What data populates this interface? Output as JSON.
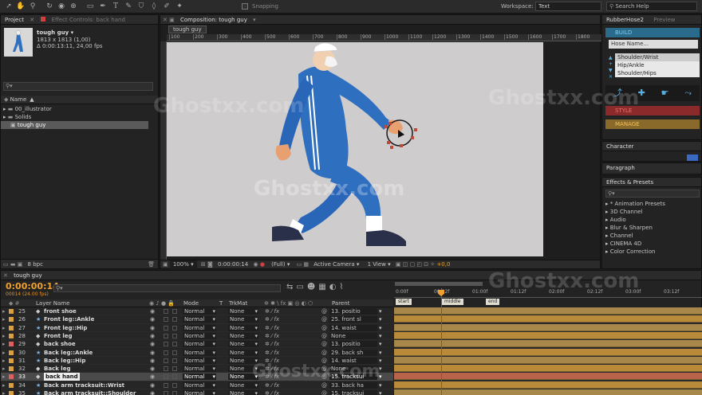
{
  "toolbar": {
    "snapping": "Snapping",
    "workspace_label": "Workspace:",
    "workspace_value": "Text",
    "search_placeholder": "Search Help"
  },
  "project": {
    "tab": "Project",
    "effect_controls": "Effect Controls: back hand",
    "comp_name": "tough guy ▾",
    "comp_dims": "1813 x 1813 (1,00)",
    "comp_duration": "Δ 0:00:13:11, 24,00 fps",
    "name_header": "Name",
    "items": [
      {
        "label": "00_illustrator",
        "type": "folder"
      },
      {
        "label": "Solids",
        "type": "folder"
      },
      {
        "label": "tough guy",
        "type": "comp"
      }
    ],
    "bpc": "8 bpc"
  },
  "composition": {
    "tab": "Composition: tough guy",
    "subtab": "tough guy",
    "ruler": [
      "100",
      "200",
      "300",
      "400",
      "500",
      "600",
      "700",
      "800",
      "900",
      "1000",
      "1100",
      "1200",
      "1300",
      "1400",
      "1500",
      "1600",
      "1700",
      "1800"
    ],
    "zoom": "100%",
    "time": "0:00:00:14",
    "resolution": "(Full)",
    "camera": "Active Camera",
    "view": "1 View",
    "exposure": "+0,0"
  },
  "rubberhose": {
    "tab": "RubberHose2",
    "preview_tab": "Preview",
    "build": "BUILD",
    "hose_name_placeholder": "Hose Name...",
    "list": [
      "Shoulder/Wrist",
      "Hip/Ankle",
      "Shoulder/Hips"
    ],
    "style": "STYLE",
    "manage": "MANAGE"
  },
  "character_tab": "Character",
  "paragraph_tab": "Paragraph",
  "effects": {
    "tab": "Effects & Presets",
    "items": [
      "* Animation Presets",
      "3D Channel",
      "Audio",
      "Blur & Sharpen",
      "Channel",
      "CINEMA 4D",
      "Color Correction"
    ]
  },
  "timeline": {
    "tab": "tough guy",
    "timecode": "0:00:00:14",
    "frame_info": "00014 (24.00 fps)",
    "headers": {
      "layer_name": "Layer Name",
      "mode": "Mode",
      "t": "T",
      "trkmat": "TrkMat",
      "parent": "Parent"
    },
    "ruler": [
      "0:00f",
      "00:12f",
      "01:00f",
      "01:12f",
      "02:00f",
      "02:12f",
      "03:00f",
      "03:12f"
    ],
    "markers": [
      "start",
      "middle",
      "end"
    ],
    "layers": [
      {
        "num": "25",
        "name": "front shoe",
        "mode": "Normal",
        "trkmat": "None",
        "parent": "13. positio",
        "color": "#d8a040",
        "shape": false
      },
      {
        "num": "26",
        "name": "Front leg::Ankle",
        "mode": "Normal",
        "trkmat": "None",
        "parent": "25. front sl",
        "color": "#d8a040",
        "shape": true
      },
      {
        "num": "27",
        "name": "Front leg::Hip",
        "mode": "Normal",
        "trkmat": "None",
        "parent": "14. waist",
        "color": "#d8a040",
        "shape": true
      },
      {
        "num": "28",
        "name": "Front leg",
        "mode": "Normal",
        "trkmat": "None",
        "parent": "None",
        "color": "#d8a040",
        "shape": false
      },
      {
        "num": "29",
        "name": "back shoe",
        "mode": "Normal",
        "trkmat": "None",
        "parent": "13. positio",
        "color": "#e06060",
        "shape": false
      },
      {
        "num": "30",
        "name": "Back leg::Ankle",
        "mode": "Normal",
        "trkmat": "None",
        "parent": "29. back sh",
        "color": "#d8a040",
        "shape": true
      },
      {
        "num": "31",
        "name": "Back leg::Hip",
        "mode": "Normal",
        "trkmat": "None",
        "parent": "14. waist",
        "color": "#d8a040",
        "shape": true
      },
      {
        "num": "32",
        "name": "Back leg",
        "mode": "Normal",
        "trkmat": "None",
        "parent": "None",
        "color": "#d8a040",
        "shape": false
      },
      {
        "num": "33",
        "name": "back hand",
        "mode": "Normal",
        "trkmat": "None",
        "parent": "15. tracksui",
        "color": "#e06060",
        "shape": false,
        "selected": true
      },
      {
        "num": "34",
        "name": "Back arm tracksuit::Wrist",
        "mode": "Normal",
        "trkmat": "None",
        "parent": "33. back ha",
        "color": "#d8a040",
        "shape": true
      },
      {
        "num": "35",
        "name": "Back arm tracksuit::Shoulder",
        "mode": "Normal",
        "trkmat": "None",
        "parent": "15. tracksui",
        "color": "#d8a040",
        "shape": true
      }
    ]
  },
  "watermark": "Ghostxx.com",
  "colors": {
    "accent_orange": "#f0a030",
    "timeline_bar": "#a8874a",
    "selected_bar": "#b8634a",
    "comp_bg": "#cfcccd",
    "tracksuit": "#2f6fc0"
  }
}
